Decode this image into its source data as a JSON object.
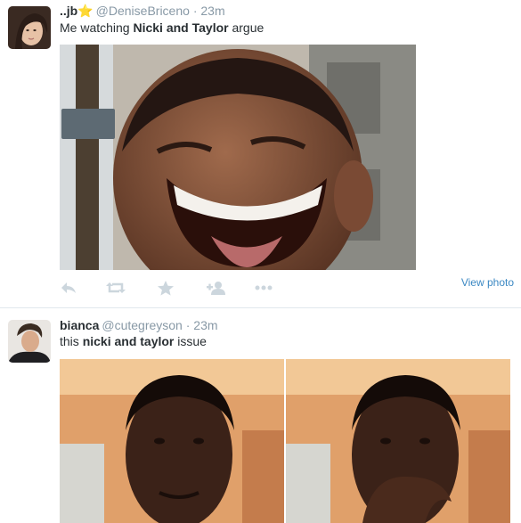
{
  "tweets": [
    {
      "fullname": "..jb⭐",
      "username": "@DeniseBriceno",
      "separator": "·",
      "time": "23m",
      "text_parts": [
        "Me watching ",
        "Nicki and Taylor",
        " argue"
      ],
      "view_photo": "View photo"
    },
    {
      "fullname": "bianca",
      "username": "@cutegreyson",
      "separator": "·",
      "time": "23m",
      "text_parts": [
        "this ",
        "nicki and taylor",
        " issue"
      ]
    }
  ],
  "icons": {
    "actions": [
      "reply-icon",
      "retweet-icon",
      "favorite-icon",
      "follow-icon",
      "more-icon"
    ]
  },
  "colors": {
    "link": "#3b88c3",
    "muted": "#8899a6",
    "action_icon": "#ccd6dd"
  }
}
